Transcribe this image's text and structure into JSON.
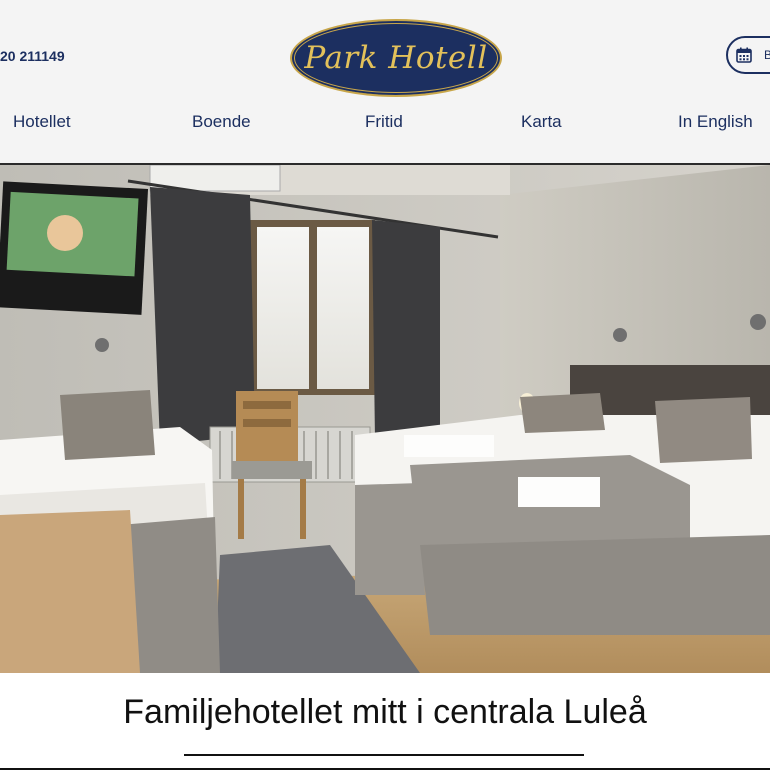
{
  "header": {
    "phone": "20 211149",
    "logo_text": "Park Hotell",
    "book_label": "B",
    "book_icon": "calendar-icon",
    "accent_color": "#1c2f60",
    "logo_gold": "#c8a64a"
  },
  "nav": {
    "items": [
      {
        "label": "Hotellet"
      },
      {
        "label": "Boende"
      },
      {
        "label": "Fritid"
      },
      {
        "label": "Karta"
      },
      {
        "label": "In English"
      }
    ]
  },
  "hero": {
    "image": "hotel-room-photo"
  },
  "main": {
    "tagline": "Familjehotellet mitt i centrala Luleå"
  }
}
